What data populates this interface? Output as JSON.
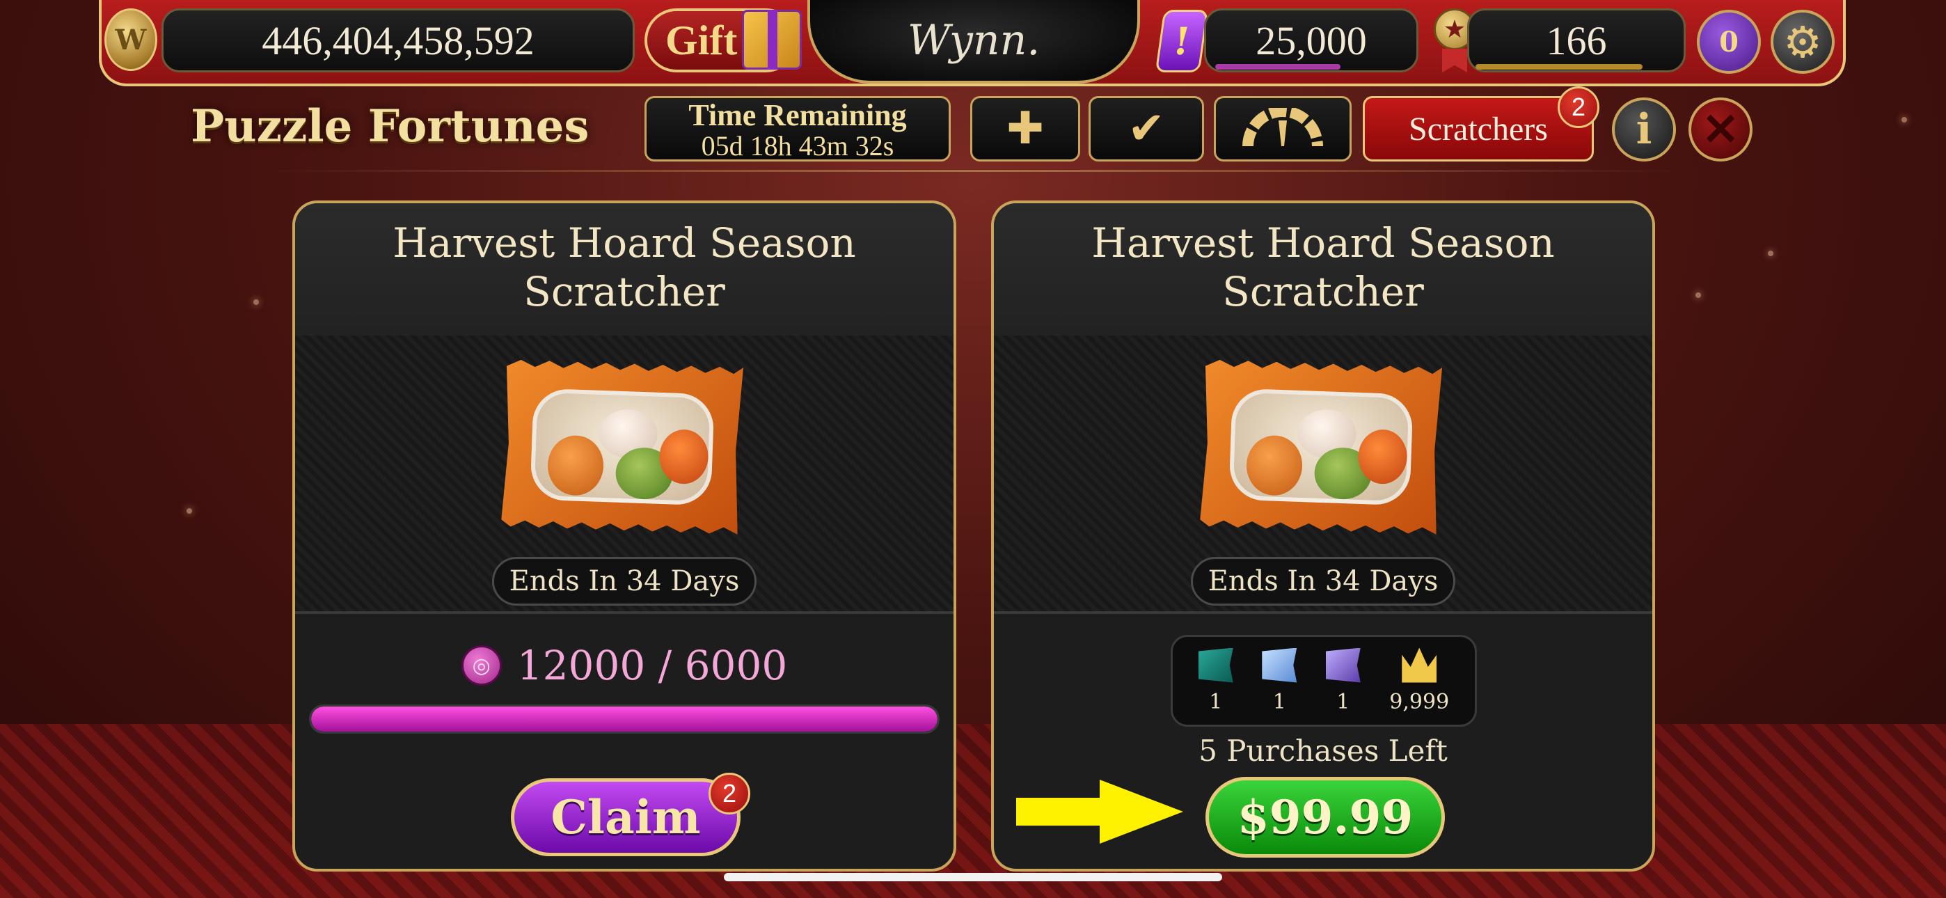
{
  "top_bar": {
    "coins": "446,404,458,592",
    "gift_label": "Gift",
    "logo_text": "Wynn.",
    "gems": "25,000",
    "level": "166",
    "vip_level": "0"
  },
  "header": {
    "title": "Puzzle Fortunes",
    "time_remaining_label": "Time Remaining",
    "time_remaining_value": "05d 18h 43m 32s",
    "scratchers_label": "Scratchers",
    "scratchers_badge": "2"
  },
  "cards": [
    {
      "title_line1": "Harvest Hoard Season",
      "title_line2": "Scratcher",
      "ends_text": "Ends In 34 Days",
      "progress_text": "12000 / 6000",
      "progress_fraction": 1.0,
      "claim_label": "Claim",
      "claim_badge": "2"
    },
    {
      "title_line1": "Harvest Hoard Season",
      "title_line2": "Scratcher",
      "ends_text": "Ends In 34 Days",
      "rewards": [
        {
          "icon": "green-ticket-icon",
          "count": "1"
        },
        {
          "icon": "blue-ticket-icon",
          "count": "1"
        },
        {
          "icon": "purple-ticket-icon",
          "count": "1"
        },
        {
          "icon": "crown-icon",
          "count": "9,999"
        }
      ],
      "purchases_left": "5 Purchases Left",
      "price_label": "$99.99"
    }
  ],
  "colors": {
    "accent_gold": "#e8c77a",
    "top_bar_red": "#b81d1d",
    "progress_magenta": "#ff50e0",
    "claim_purple": "#8a1ac8",
    "buy_green": "#1aa81a",
    "arrow_yellow": "#fff200"
  }
}
